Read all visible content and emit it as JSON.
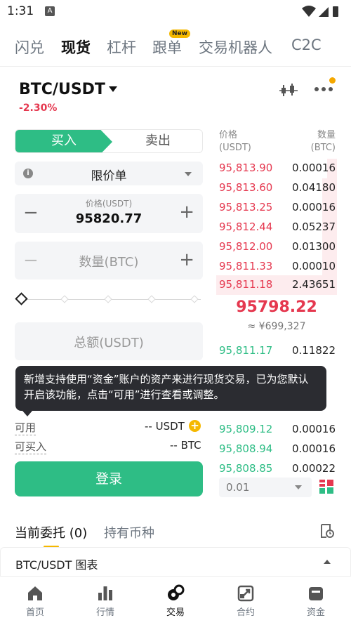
{
  "status_bar": {
    "time": "1:31",
    "notification_icon": "A"
  },
  "top_tabs": [
    {
      "label": "闪兑",
      "active": false
    },
    {
      "label": "现货",
      "active": true
    },
    {
      "label": "杠杆",
      "active": false
    },
    {
      "label": "跟单",
      "active": false
    },
    {
      "label": "交易机器人",
      "active": false
    },
    {
      "label": "C2C",
      "active": false
    }
  ],
  "new_badge": "New",
  "pair": {
    "symbol": "BTC/USDT",
    "change": "-2.30%"
  },
  "form": {
    "buy_label": "买入",
    "sell_label": "卖出",
    "order_type": "限价单",
    "price_caption": "价格(USDT)",
    "price_value": "95820.77",
    "qty_placeholder": "数量(BTC)",
    "total_placeholder": "总额(USDT)",
    "tooltip": "新增支持使用“资金”账户的资产来进行现货交易，已为您默认开启该功能，点击“可用”进行查看或调整。",
    "available_label": "可用",
    "available_value": "-- USDT",
    "can_buy_label": "可买入",
    "can_buy_value": "-- BTC",
    "login_label": "登录"
  },
  "order_book": {
    "price_header_1": "价格",
    "price_header_2": "(USDT)",
    "qty_header_1": "数量",
    "qty_header_2": "(BTC)",
    "asks": [
      {
        "price": "95,813.90",
        "qty": "0.00016"
      },
      {
        "price": "95,813.60",
        "qty": "0.04180"
      },
      {
        "price": "95,813.25",
        "qty": "0.00016"
      },
      {
        "price": "95,812.44",
        "qty": "0.05237"
      },
      {
        "price": "95,812.00",
        "qty": "0.01300"
      },
      {
        "price": "95,811.33",
        "qty": "0.00010"
      },
      {
        "price": "95,811.18",
        "qty": "2.43651"
      }
    ],
    "last_price": "95798.22",
    "last_price_cny": "≈ ¥699,327",
    "bids": [
      {
        "price": "95,811.17",
        "qty": "0.11822"
      },
      {
        "price": "95,809.12",
        "qty": "0.00016"
      },
      {
        "price": "95,808.94",
        "qty": "0.00016"
      },
      {
        "price": "95,808.85",
        "qty": "0.00022"
      }
    ],
    "precision": "0.01"
  },
  "lower_tabs": {
    "open_orders": "当前委托 (0)",
    "holdings": "持有币种"
  },
  "chart_toggle": "BTC/USDT 图表",
  "nav": [
    {
      "label": "首页",
      "icon": "home-icon",
      "active": false
    },
    {
      "label": "行情",
      "icon": "market-icon",
      "active": false
    },
    {
      "label": "交易",
      "icon": "trade-icon",
      "active": true
    },
    {
      "label": "合约",
      "icon": "futures-icon",
      "active": false
    },
    {
      "label": "资金",
      "icon": "wallet-icon",
      "active": false
    }
  ],
  "colors": {
    "green": "#2ebd85",
    "red": "#e5384f",
    "accent": "#f5b800"
  }
}
